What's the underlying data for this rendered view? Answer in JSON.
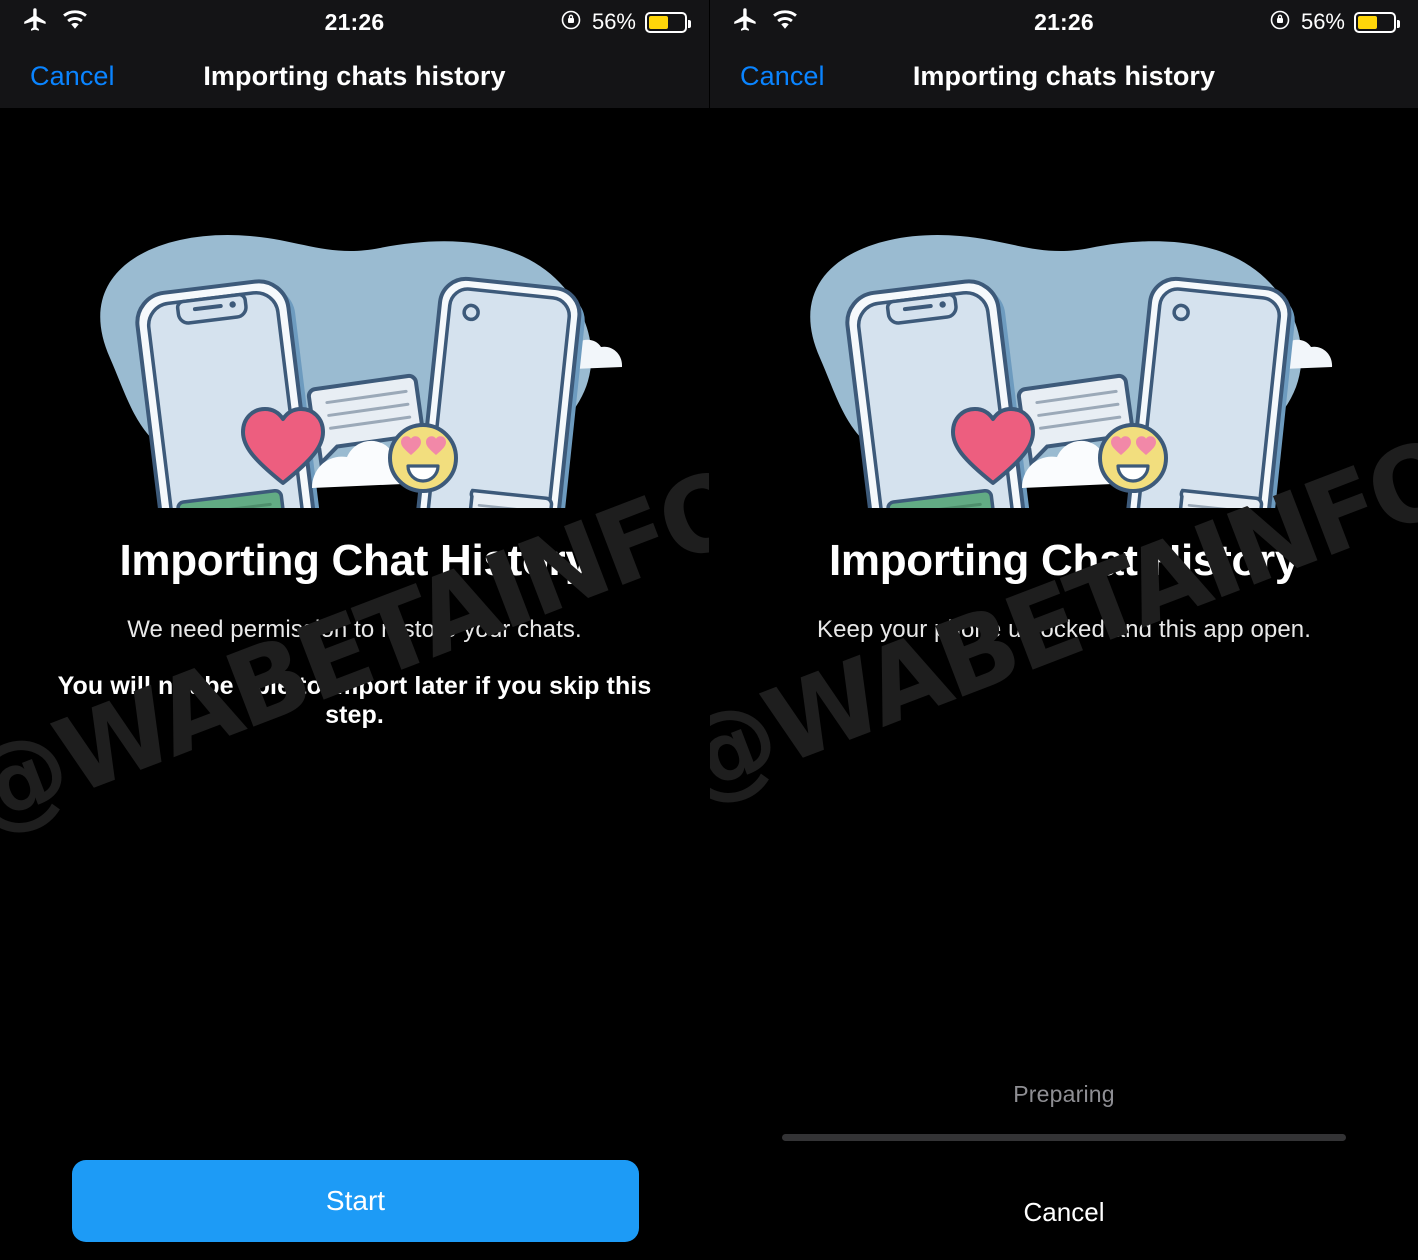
{
  "colors": {
    "accent_blue": "#1D9BF6",
    "link_blue": "#0A84FF",
    "battery_yellow": "#FFD60A",
    "background": "#000000",
    "navbar": "#141416",
    "blob": "#9ABBD1",
    "phone_screen": "#D5E2EE",
    "outline": "#3D5A7A",
    "bubble_green": "#62AB84",
    "heart_pink": "#ED5E7F",
    "emoji_yellow": "#F2DE7E",
    "progress_track": "#333335",
    "muted_text": "#8E8E93"
  },
  "watermark": "@WABETAINFO",
  "panels": [
    {
      "status_bar": {
        "airplane_icon": "airplane-mode-icon",
        "wifi_icon": "wifi-icon",
        "time": "21:26",
        "rotation_lock_icon": "rotation-lock-icon",
        "battery_percent": "56%",
        "battery_level": 56
      },
      "nav": {
        "cancel_label": "Cancel",
        "title": "Importing chats history"
      },
      "illustration": "two-phones-syncing-chats",
      "title": "Importing Chat History",
      "subtitle": "We need permission to restore your chats.",
      "warning": "You will not be able to import later if you skip this step.",
      "primary_button": "Start"
    },
    {
      "status_bar": {
        "airplane_icon": "airplane-mode-icon",
        "wifi_icon": "wifi-icon",
        "time": "21:26",
        "rotation_lock_icon": "rotation-lock-icon",
        "battery_percent": "56%",
        "battery_level": 56
      },
      "nav": {
        "cancel_label": "Cancel",
        "title": "Importing chats history"
      },
      "illustration": "two-phones-syncing-chats",
      "title": "Importing Chat History",
      "subtitle": "Keep your phone unlocked and this app open.",
      "progress": {
        "status_label": "Preparing",
        "percent": 0
      },
      "cancel_button": "Cancel"
    }
  ]
}
